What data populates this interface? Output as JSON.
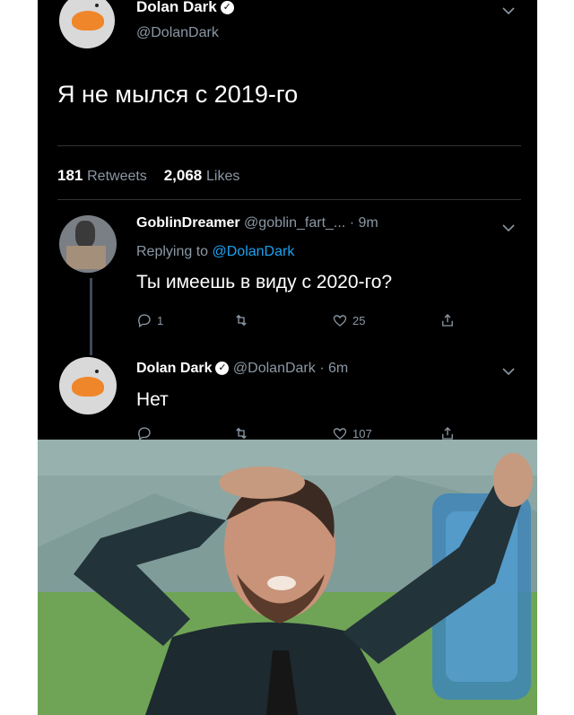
{
  "main_tweet": {
    "display_name": "Dolan Dark",
    "handle": "@DolanDark",
    "text": "Я не мылся с 2019-го",
    "stats": {
      "retweets_count": "181",
      "retweets_label": "Retweets",
      "likes_count": "2,068",
      "likes_label": "Likes"
    }
  },
  "reply": {
    "display_name": "GoblinDreamer",
    "handle": "@goblin_fart_...",
    "time": "· 9m",
    "replying_prefix": "Replying to",
    "replying_to": "@DolanDark",
    "text": "Ты имеешь в виду с 2020-го?",
    "actions": {
      "replies": "1",
      "likes": "25"
    }
  },
  "answer": {
    "display_name": "Dolan Dark",
    "handle": "@DolanDark · 6m",
    "text": "Нет",
    "actions": {
      "likes": "107"
    }
  },
  "icons": [
    "verified-icon",
    "chevron-down-icon",
    "reply-icon",
    "retweet-icon",
    "like-icon",
    "share-icon"
  ],
  "colors": {
    "background": "#000000",
    "secondary_text": "#8b98a5",
    "link": "#1da1f2"
  }
}
